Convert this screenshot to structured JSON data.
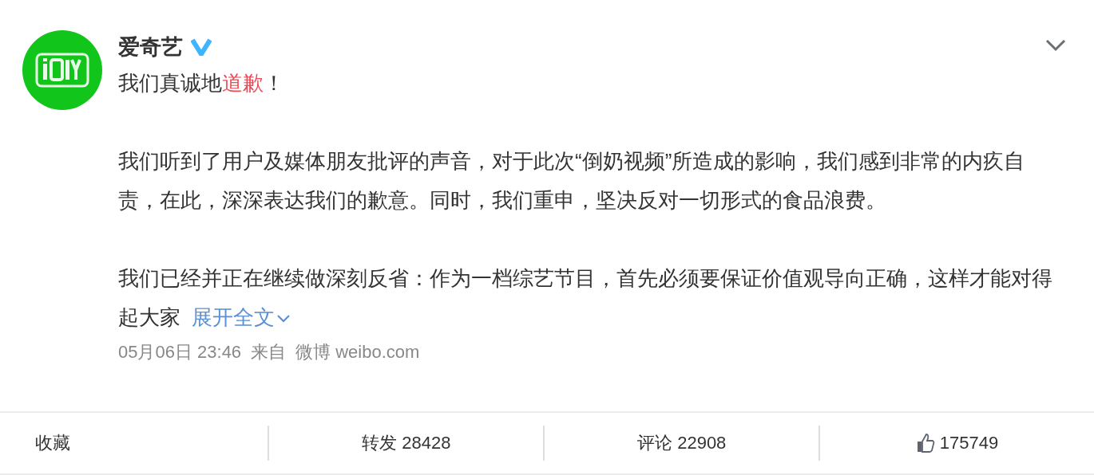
{
  "post": {
    "author": "爱奇艺",
    "verified": true,
    "headline": [
      {
        "text": "我们真诚地",
        "highlight": false
      },
      {
        "text": "道歉",
        "highlight": true
      },
      {
        "text": "！",
        "highlight": false
      }
    ],
    "paragraphs": [
      "我们听到了用户及媒体朋友批评的声音，对于此次“倒奶视频”所造成的影响，我们感到非常的内疚自责，在此，深深表达我们的歉意。同时，我们重申，坚决反对一切形式的食品浪费。",
      "我们已经并正在继续做深刻反省：作为一档综艺节目，首先必须要保证价值观导向正确，这样才能对得起大家"
    ],
    "expand_link": "展开全文",
    "time": "05月06日 23:46",
    "source_prefix": "来自",
    "source": "微博 weibo.com"
  },
  "actions": [
    {
      "kind": "plain",
      "label": "收藏"
    },
    {
      "kind": "plain",
      "label": "转发 28428"
    },
    {
      "kind": "plain",
      "label": "评论 22908"
    },
    {
      "kind": "like",
      "label": "175749"
    }
  ]
}
